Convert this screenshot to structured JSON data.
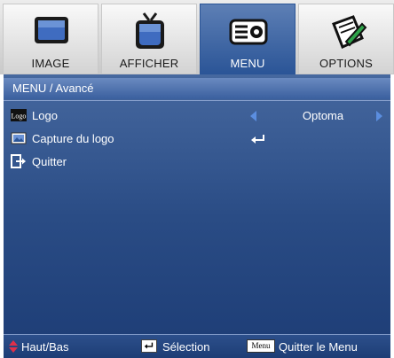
{
  "tabs": [
    {
      "label": "IMAGE",
      "icon": "monitor-icon",
      "active": false
    },
    {
      "label": "AFFICHER",
      "icon": "tv-icon",
      "active": false
    },
    {
      "label": "MENU",
      "icon": "projector-icon",
      "active": true
    },
    {
      "label": "OPTIONS",
      "icon": "options-icon",
      "active": false
    }
  ],
  "breadcrumb": "MENU / Avancé",
  "rows": [
    {
      "label": "Logo",
      "icon": "logo-icon",
      "value": "Optoma"
    },
    {
      "label": "Capture du logo",
      "icon": "capture-icon"
    },
    {
      "label": "Quitter",
      "icon": "exit-icon"
    }
  ],
  "help": {
    "updown": "Haut/Bas",
    "select": "Sélection",
    "menu_key": "Menu",
    "quit": "Quitter le Menu"
  },
  "colors": {
    "accent": "#2b5597",
    "panel": "#2a4c85",
    "arrow": "#5b8ee0",
    "updown": "#e0304a"
  }
}
